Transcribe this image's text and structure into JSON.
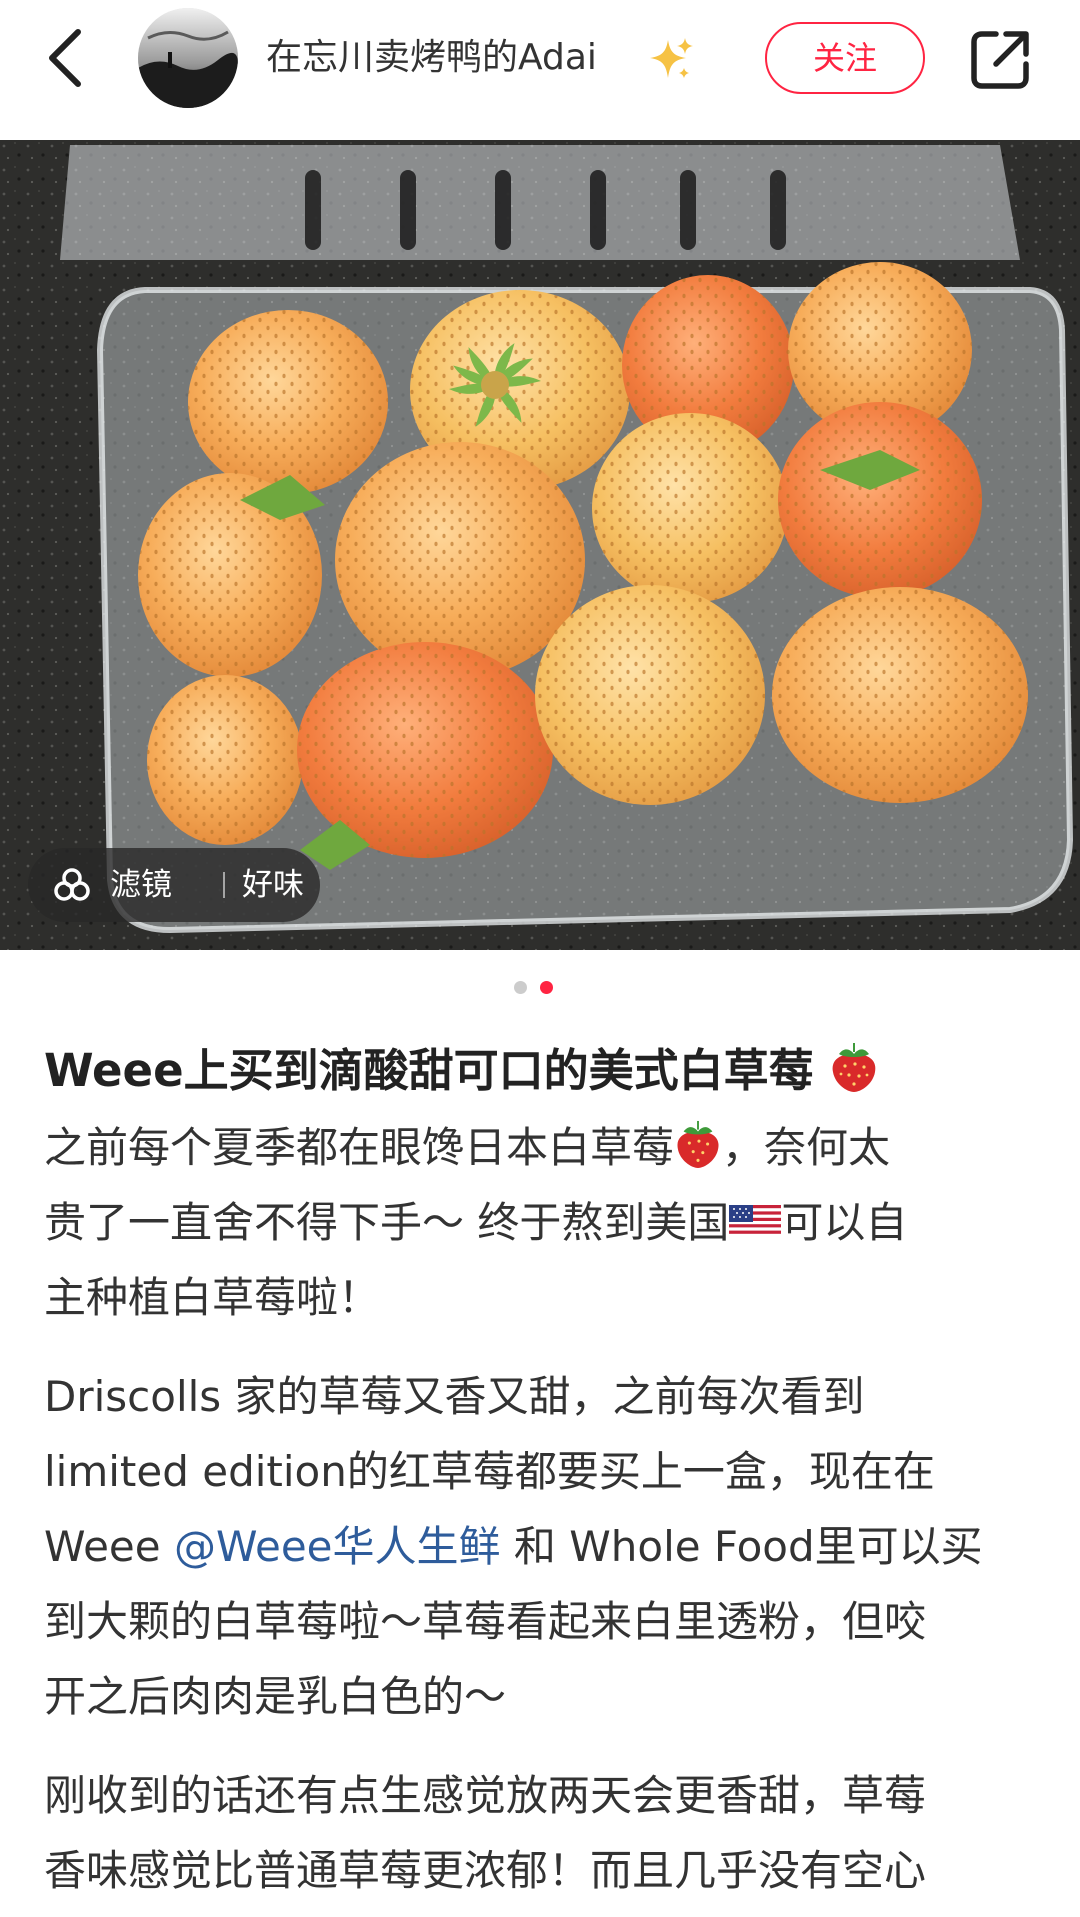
{
  "header": {
    "username": "在忘川卖烤鸭的Adai",
    "username_emoji": "sparkles-emoji",
    "follow_label": "关注"
  },
  "photo": {
    "filter_label": "滤镜",
    "filter_name": "好味",
    "pager_total": 2,
    "pager_active": 2,
    "active_dot_color": "#ff2442",
    "inactive_dot_color": "#cccccc"
  },
  "post": {
    "title": "Weee上买到滴酸甜可口的美式白草莓",
    "title_emoji": "strawberry-emoji",
    "p1_l1": "之前每个夏季都在眼馋日本白草莓",
    "p1_l1_end": "，奈何太",
    "p1_l2": "贵了一直舍不得下手～ 终于熬到美国",
    "p1_l2_end": "可以自",
    "p1_l3": "主种植白草莓啦！",
    "p2_l1": "Driscolls 家的草莓又香又甜，之前每次看到",
    "p2_l2": "limited edition的红草莓都要买上一盒，现在在",
    "p2_l3_a": "Weee ",
    "p2_l3_mention": "@Weee华人生鲜",
    "p2_l3_b": " 和 Whole Food里可以买",
    "p2_l4": "到大颗的白草莓啦～草莓看起来白里透粉，但咬",
    "p2_l5": "开之后肉肉是乳白色的～",
    "p3_l1": "刚收到的话还有点生感觉放两天会更香甜，草莓",
    "p3_l2": "香味感觉比普通草莓更浓郁！而且几乎没有空心"
  },
  "colors": {
    "accent": "#ff2442",
    "mention": "#2e5c9b"
  }
}
